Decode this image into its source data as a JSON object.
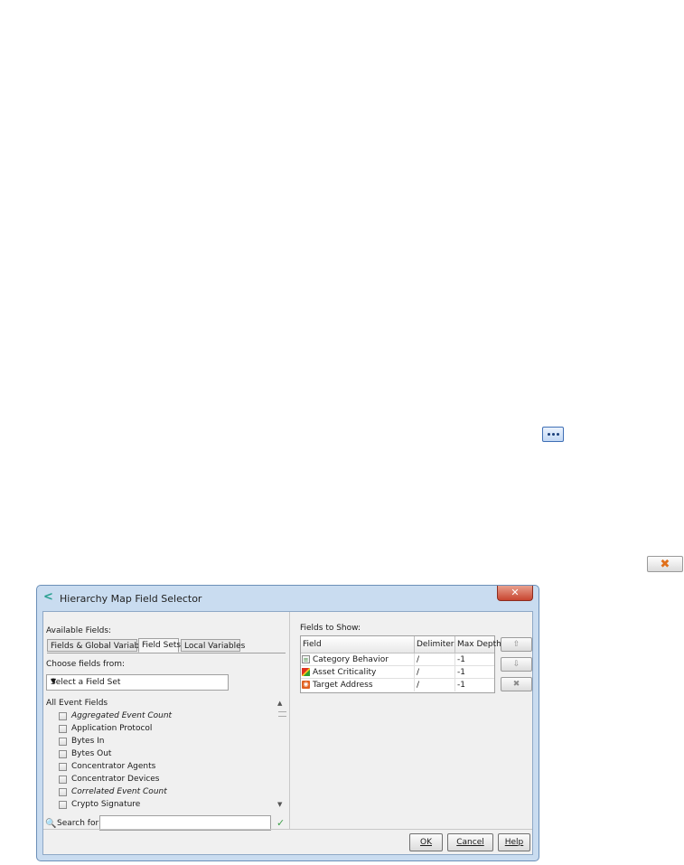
{
  "dialog": {
    "title": "Hierarchy Map Field Selector",
    "close_glyph": "✕"
  },
  "left": {
    "available_label": "Available Fields:",
    "tabs": [
      {
        "label": "Fields & Global Variables",
        "active": false
      },
      {
        "label": "Field Sets",
        "active": true
      },
      {
        "label": "Local Variables",
        "active": false
      }
    ],
    "choose_label": "Choose fields from:",
    "select_value": "Select a Field Set",
    "list_header": "All Event Fields",
    "items": [
      {
        "label": "Aggregated Event Count",
        "italic": true
      },
      {
        "label": "Application Protocol",
        "italic": false
      },
      {
        "label": "Bytes In",
        "italic": false
      },
      {
        "label": "Bytes Out",
        "italic": false
      },
      {
        "label": "Concentrator Agents",
        "italic": false
      },
      {
        "label": "Concentrator Devices",
        "italic": false
      },
      {
        "label": "Correlated Event Count",
        "italic": true
      },
      {
        "label": "Crypto Signature",
        "italic": false
      }
    ],
    "search_label": "Search for:",
    "search_value": ""
  },
  "right": {
    "fields_label": "Fields to Show:",
    "columns": [
      "Field",
      "Delimiter",
      "Max Depth"
    ],
    "rows": [
      {
        "field": "Category Behavior",
        "delimiter": "/",
        "depth": "-1",
        "icon": "category-icon"
      },
      {
        "field": "Asset Criticality",
        "delimiter": "/",
        "depth": "-1",
        "icon": "criticality-icon"
      },
      {
        "field": "Target Address",
        "delimiter": "/",
        "depth": "-1",
        "icon": "address-icon"
      }
    ]
  },
  "footer": {
    "ok": "OK",
    "cancel": "Cancel",
    "help": "Help"
  },
  "colors": {
    "title_bg": "#c9dcf0",
    "close_red": "#c84530",
    "accent_blue": "#3f6fb5"
  }
}
